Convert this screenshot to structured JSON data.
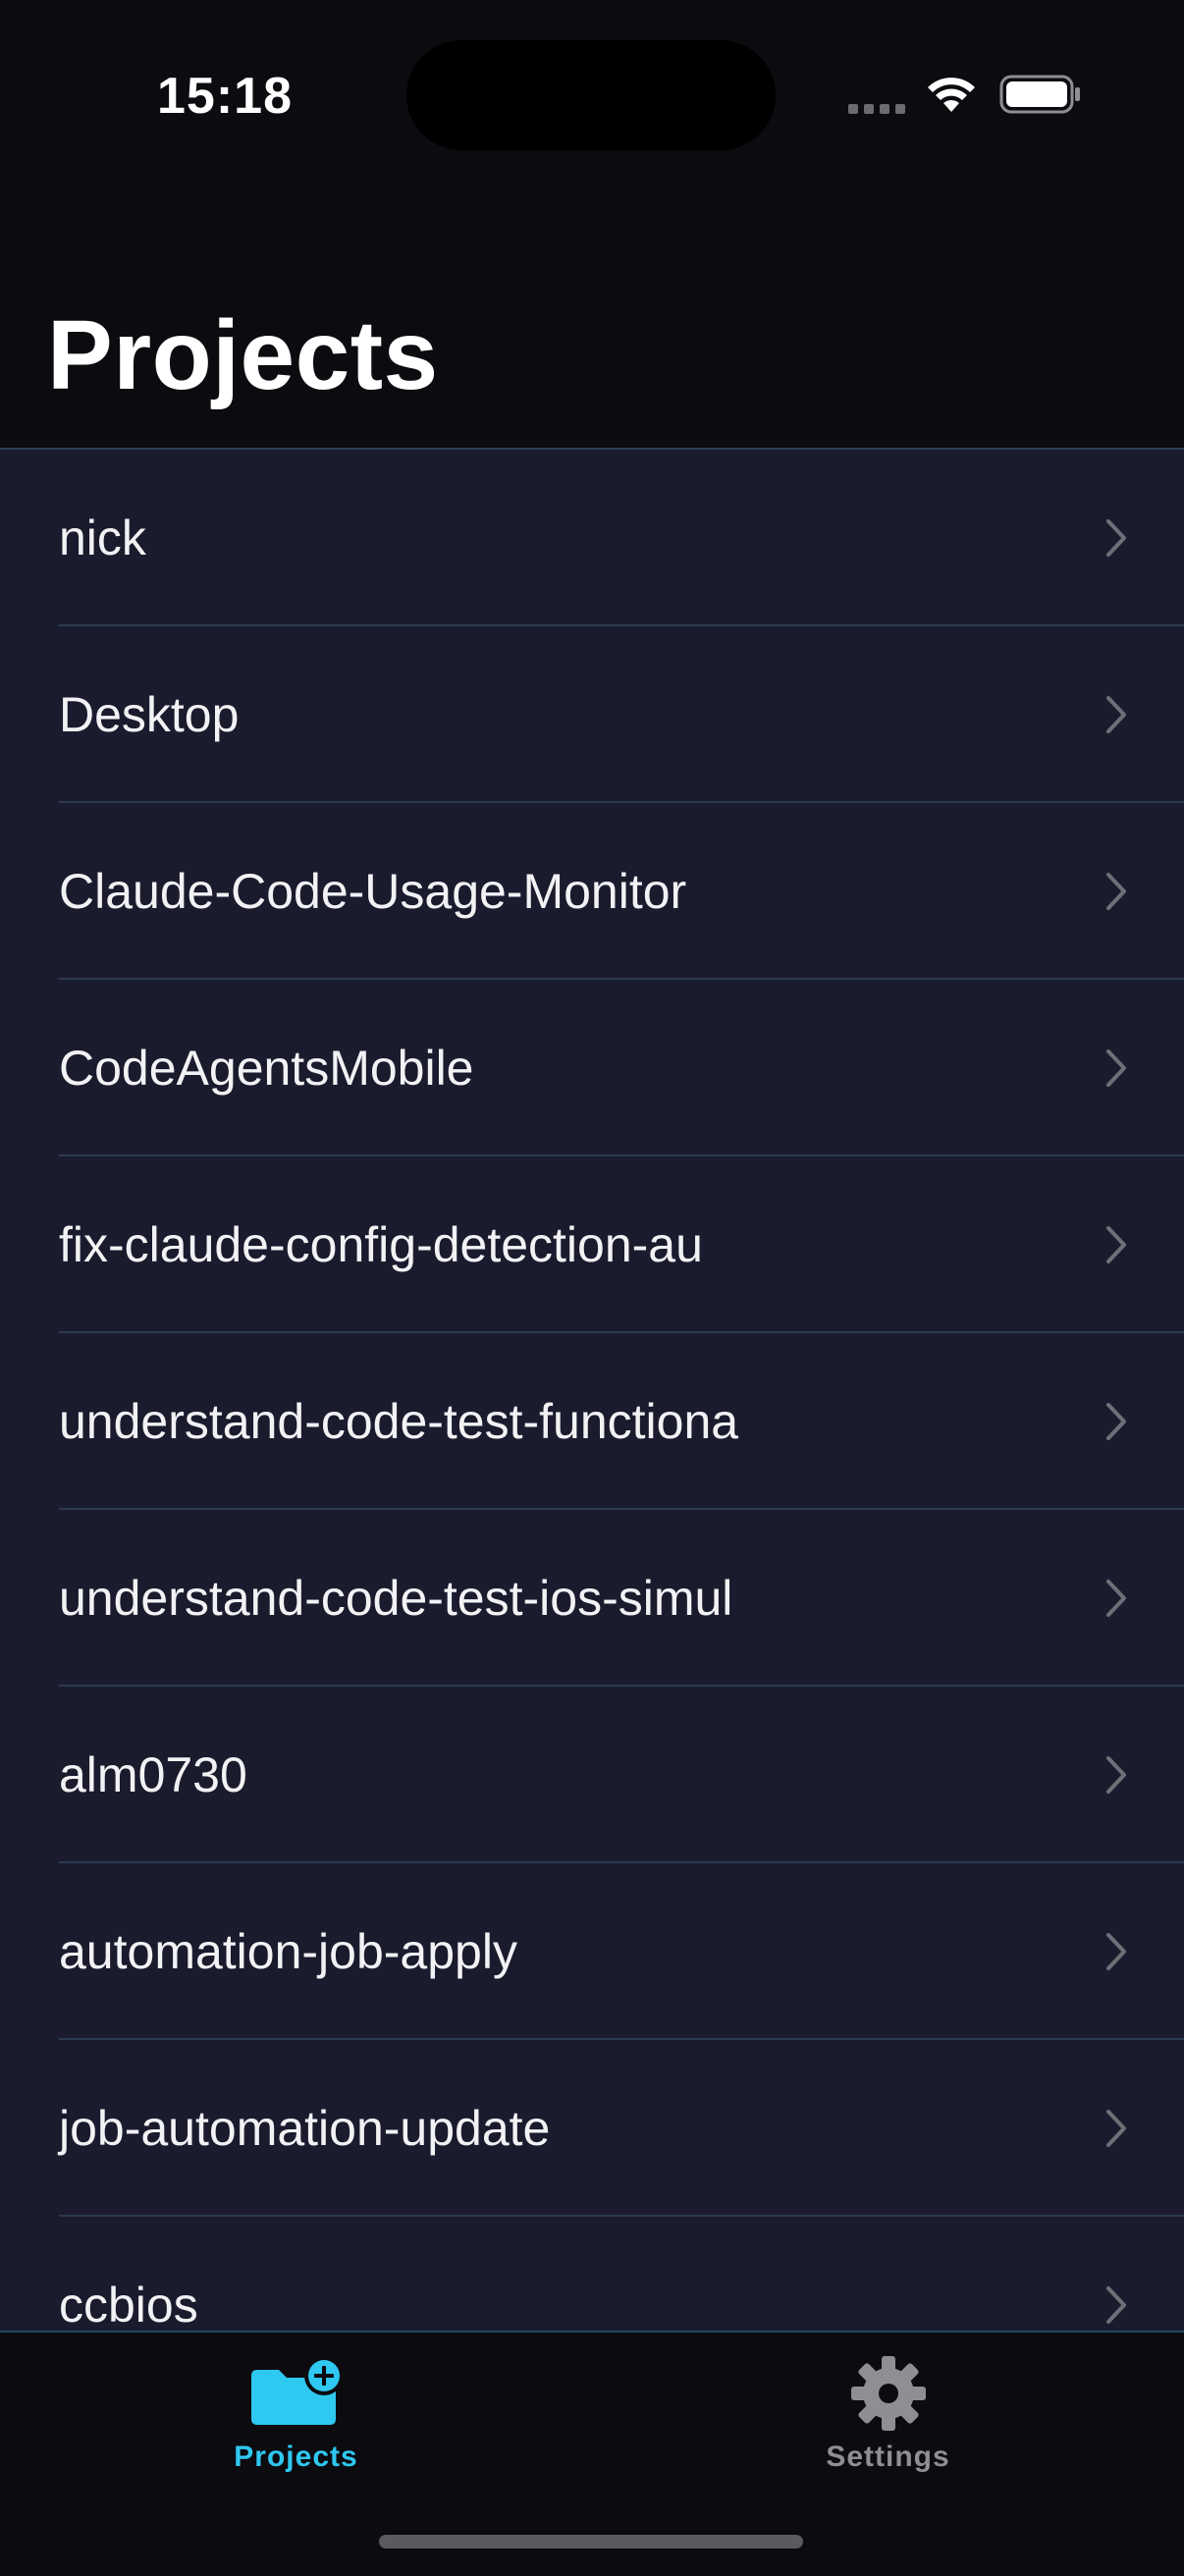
{
  "status_bar": {
    "time": "15:18"
  },
  "header": {
    "title": "Projects"
  },
  "projects": [
    {
      "label": "nick"
    },
    {
      "label": "Desktop"
    },
    {
      "label": "Claude-Code-Usage-Monitor"
    },
    {
      "label": "CodeAgentsMobile"
    },
    {
      "label": "fix-claude-config-detection-au"
    },
    {
      "label": "understand-code-test-functiona"
    },
    {
      "label": "understand-code-test-ios-simul"
    },
    {
      "label": "alm0730"
    },
    {
      "label": "automation-job-apply"
    },
    {
      "label": "job-automation-update"
    },
    {
      "label": "ccbios"
    }
  ],
  "tab_bar": {
    "tabs": [
      {
        "label": "Projects",
        "icon": "folder-plus-icon",
        "active": true,
        "color": "#2ec8f0"
      },
      {
        "label": "Settings",
        "icon": "gear-icon",
        "active": false,
        "color": "#8e8e93"
      }
    ]
  },
  "colors": {
    "background": "#0b0b10",
    "list_background": "#1b1b2e",
    "accent": "#2ec8f0",
    "chevron": "#6f6f78"
  }
}
